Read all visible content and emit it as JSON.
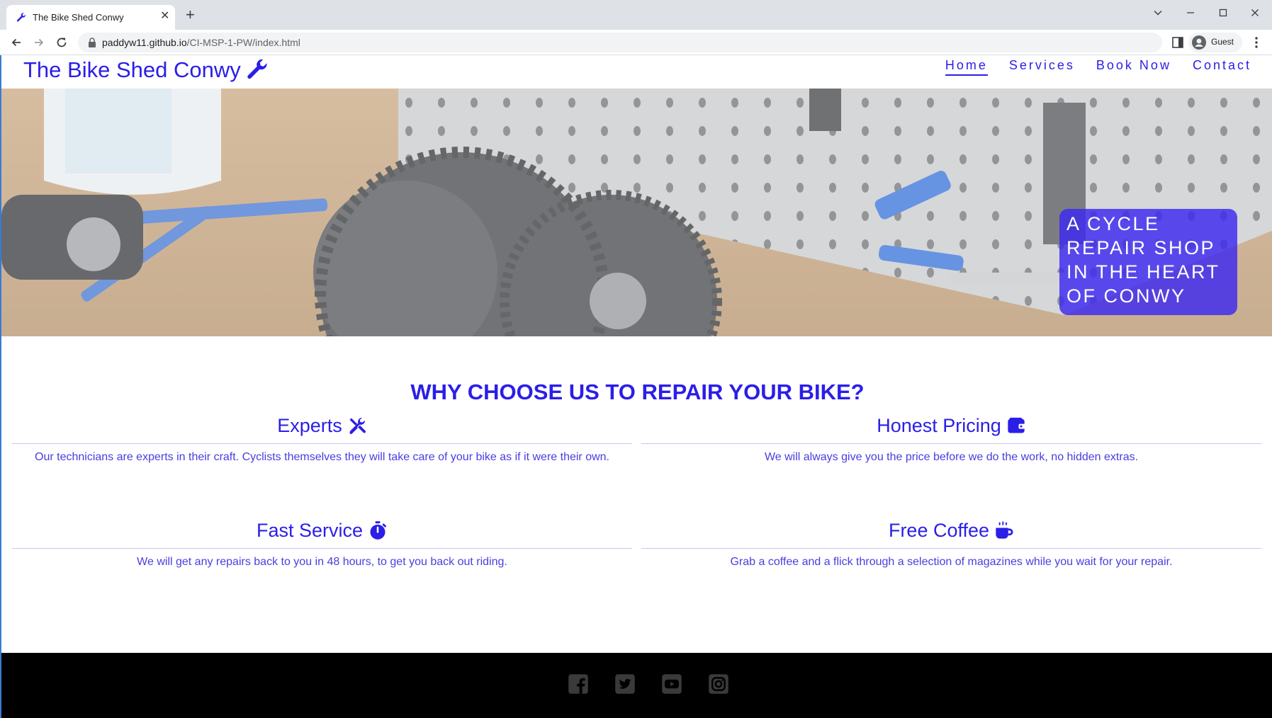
{
  "browser": {
    "tab_title": "The Bike Shed Conwy",
    "url_host": "paddyw11.github.io",
    "url_path": "/CI-MSP-1-PW/index.html",
    "profile_label": "Guest"
  },
  "site": {
    "logo": "The Bike Shed Conwy",
    "nav": [
      "Home",
      "Services",
      "Book Now",
      "Contact"
    ],
    "tagline": "A CYCLE REPAIR SHOP IN THE HEART OF CONWY",
    "why_heading": "WHY CHOOSE US TO REPAIR YOUR BIKE?",
    "features": [
      {
        "title": "Experts",
        "icon": "tools-icon",
        "text": "Our technicians are experts in their craft. Cyclists themselves they will take care of your bike as if it were their own."
      },
      {
        "title": "Honest Pricing",
        "icon": "wallet-icon",
        "text": "We will always give you the price before we do the work, no hidden extras."
      },
      {
        "title": "Fast Service",
        "icon": "stopwatch-icon",
        "text": "We will get any repairs back to you in 48 hours, to get you back out riding."
      },
      {
        "title": "Free Coffee",
        "icon": "mug-icon",
        "text": "Grab a coffee and a flick through a selection of magazines while you wait for your repair."
      }
    ],
    "social_icons": [
      "facebook-icon",
      "twitter-icon",
      "youtube-icon",
      "instagram-icon"
    ]
  },
  "colors": {
    "brand": "#2b1ee8",
    "tagline_bg": "#3c28f0",
    "footer_bg": "#000000",
    "social_icon": "#3a3a3a"
  }
}
